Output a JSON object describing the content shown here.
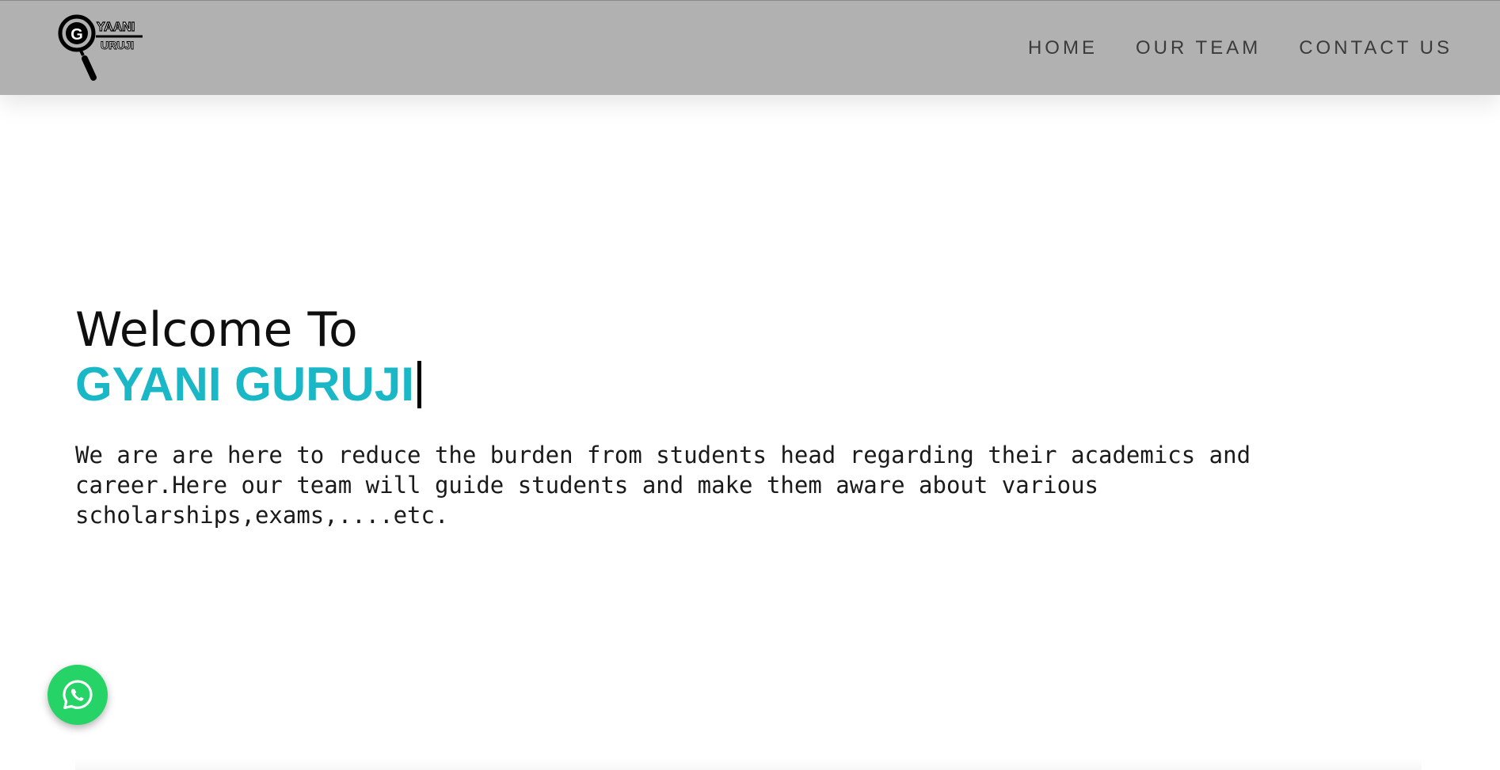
{
  "header": {
    "logo_alt": "Gyaani Guruji logo",
    "logo_text_top": "YAANI",
    "logo_text_bottom": "URUJI",
    "logo_letter": "G",
    "nav": [
      {
        "label": "HOME"
      },
      {
        "label": "OUR TEAM"
      },
      {
        "label": "CONTACT US"
      }
    ]
  },
  "hero": {
    "welcome": "Welcome To",
    "brand": "GYANI GURUJI",
    "description": "We are are here to reduce the burden from students head regarding their academics and career.Here our team will guide students and make them aware about various scholarships,exams,....etc."
  },
  "floating": {
    "whatsapp_icon": "whatsapp-icon"
  },
  "colors": {
    "navbar_bg": "#b1b1b1",
    "brand_accent": "#1ab8c7",
    "whatsapp_green": "#25d366"
  }
}
